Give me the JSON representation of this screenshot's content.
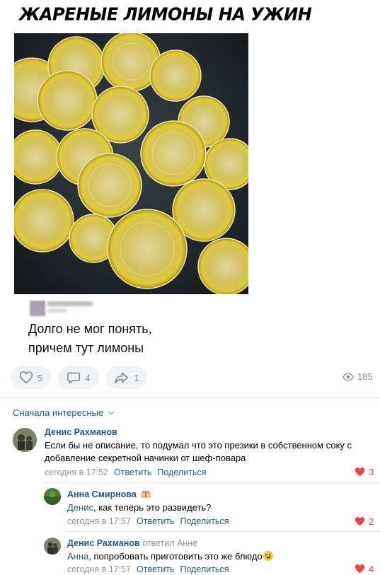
{
  "meme": {
    "title": "ЖАРЕНЫЕ ЛИМОНЫ НА УЖИН",
    "caption_lines": [
      "Долго не мог понять,",
      "причем тут лимоны"
    ]
  },
  "post_actions": {
    "likes": "5",
    "comments": "4",
    "shares": "1",
    "views": "185"
  },
  "comments_sort": "Сначала интересные",
  "comments": [
    {
      "author": "Денис Рахманов",
      "text": "Если бы не описание, то подумал что это презики в собственном соку с добавление секретной начинки от шеф-повара",
      "time": "сегодня в 17:52",
      "reply_label": "Ответить",
      "share_label": "Поделиться",
      "likes": "3"
    },
    {
      "author": "Анна Смирнова",
      "mention": "Денис",
      "text": ", как теперь это развидеть?",
      "time": "сегодня в 17:57",
      "reply_label": "Ответить",
      "share_label": "Поделиться",
      "likes": "2"
    },
    {
      "author": "Денис Рахманов",
      "replied_to": "ответил Анне",
      "mention": "Анна",
      "text": ", попробовать приготовить это же блюдо",
      "time": "сегодня в 17:57",
      "reply_label": "Ответить",
      "share_label": "Поделиться",
      "likes": "4"
    }
  ],
  "colors": {
    "link": "#2a5885",
    "muted": "#818c99",
    "like_red": "#e64646",
    "button_bg": "#f0f2f5"
  },
  "icons": [
    "heart-icon",
    "comment-icon",
    "share-icon",
    "eye-icon",
    "chevron-down-icon",
    "liked-heart-icon",
    "gift-icon",
    "emoji-icon"
  ]
}
